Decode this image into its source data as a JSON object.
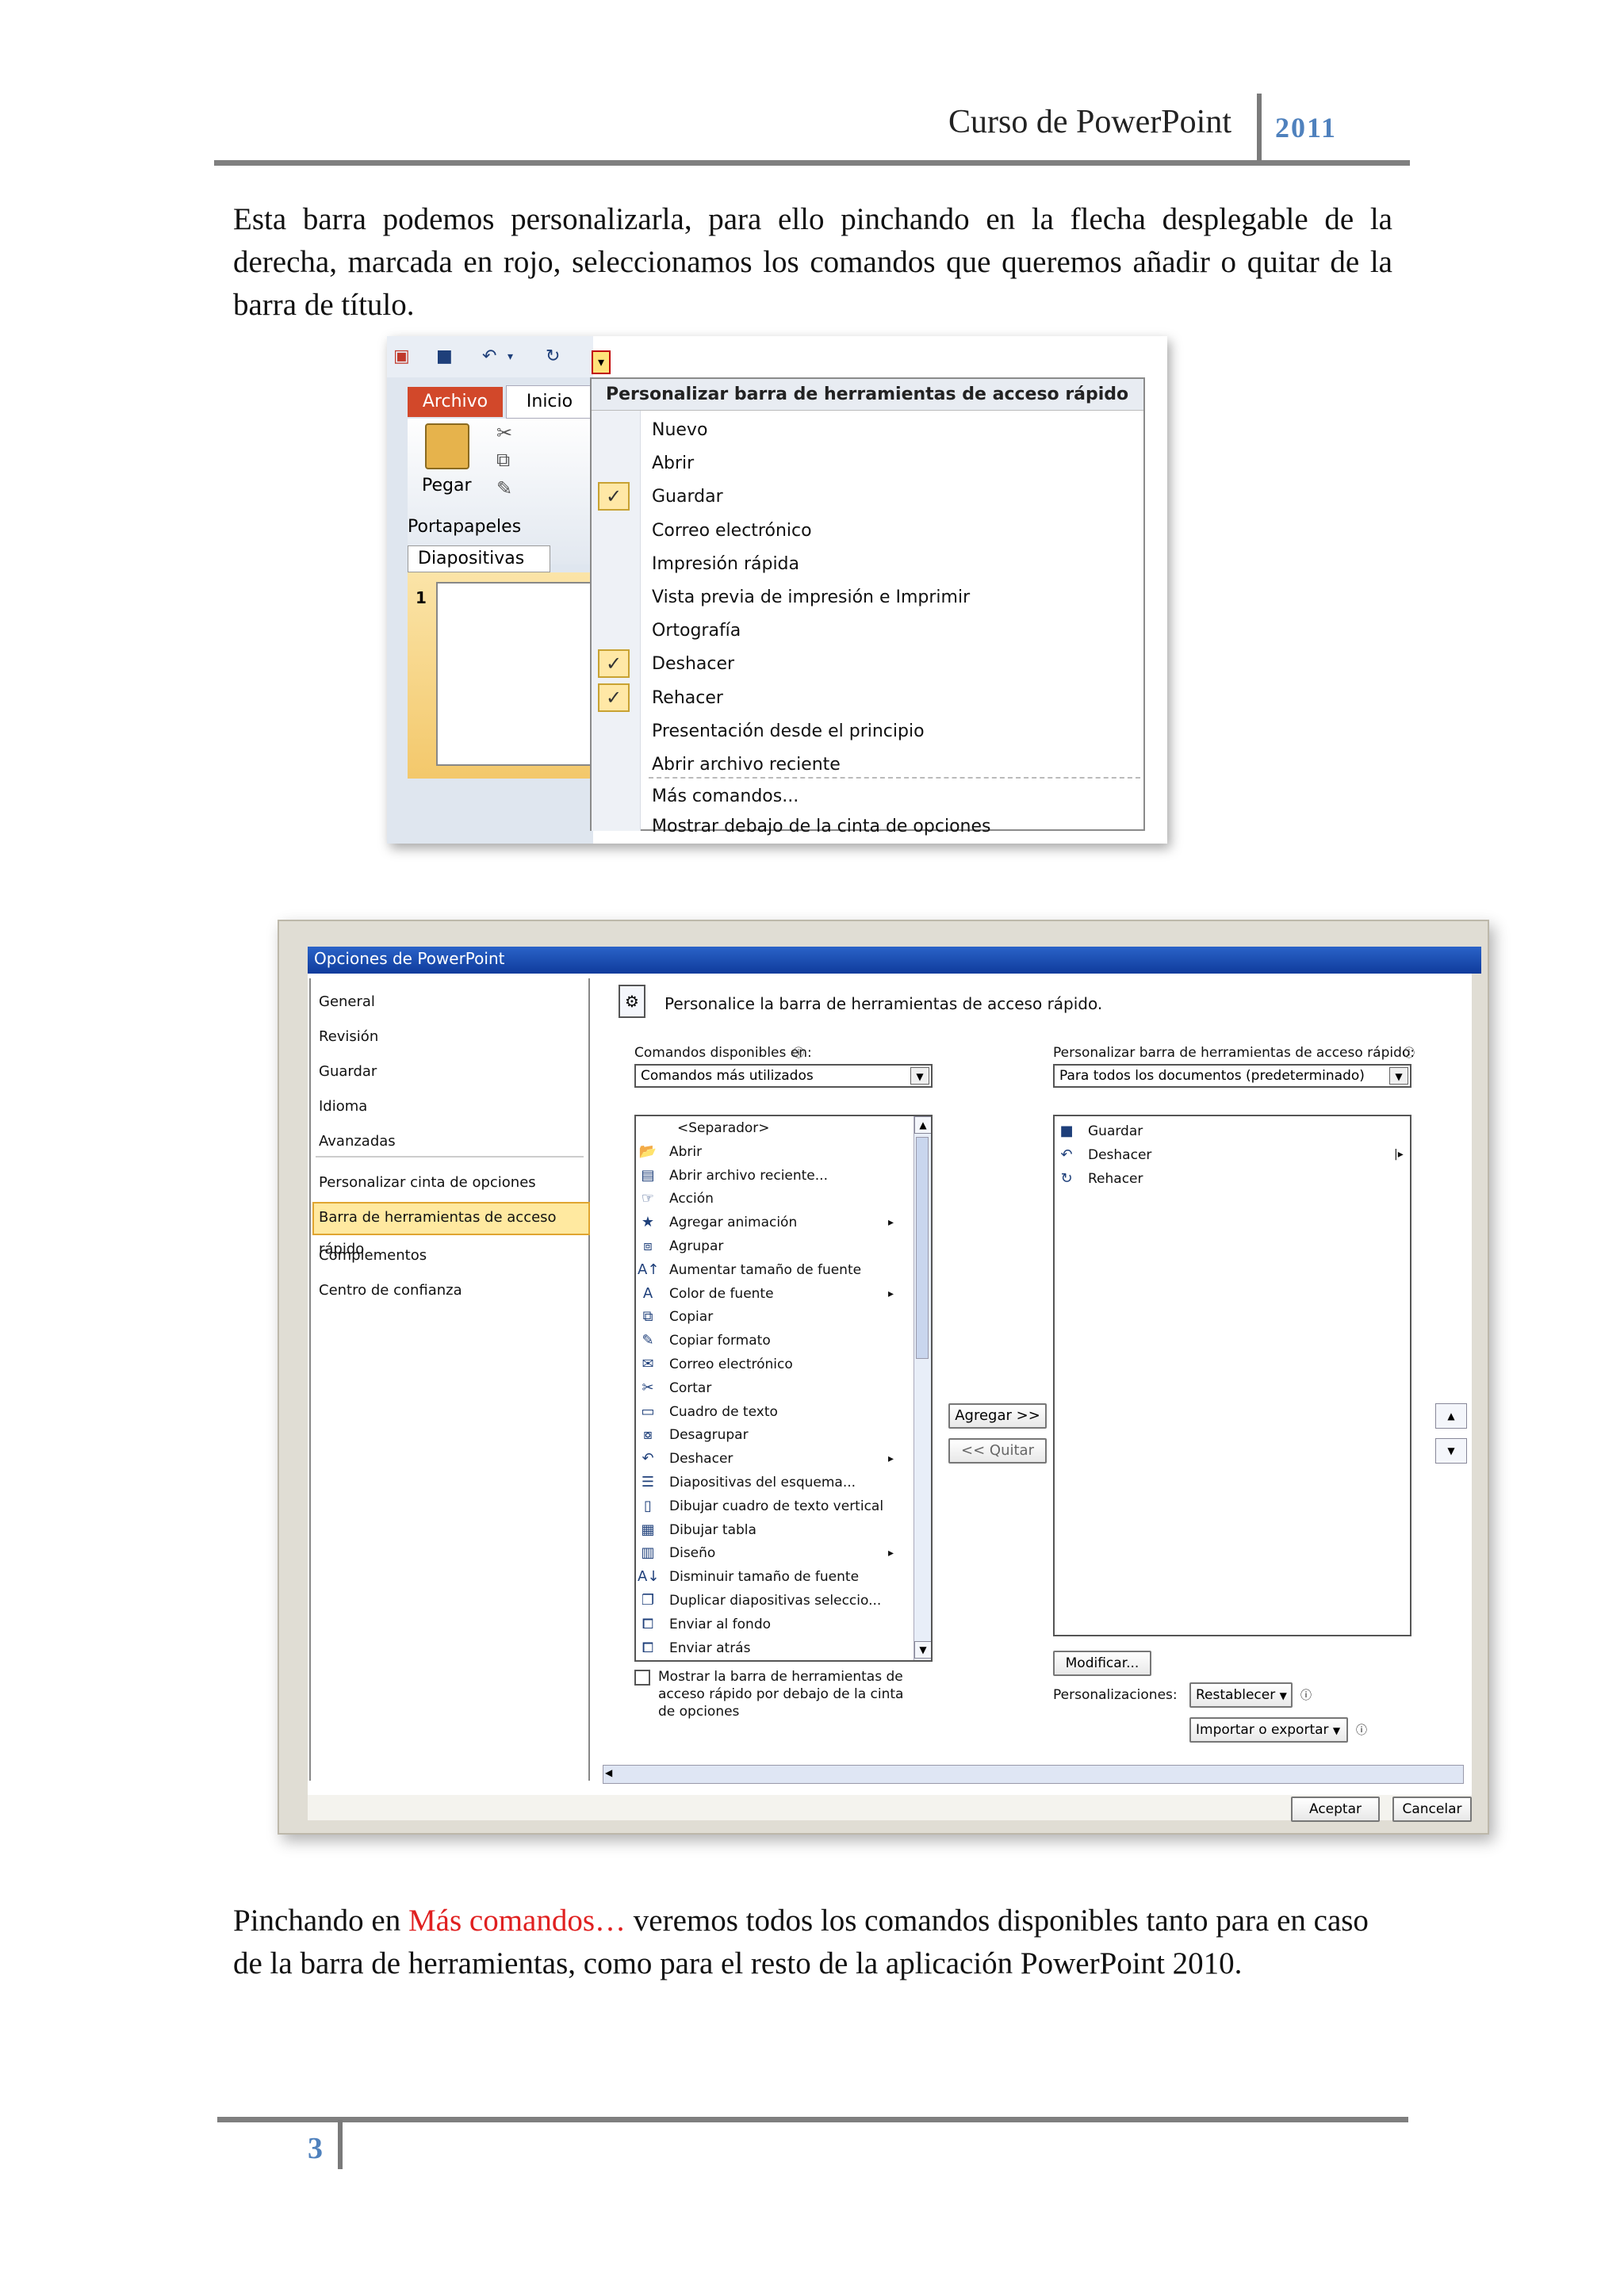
{
  "header": {
    "title": "Curso de PowerPoint",
    "year": "2011"
  },
  "paragraph1": "Esta barra podemos personalizarla, para ello pinchando en la flecha desplegable de la derecha, marcada en rojo, seleccionamos los comandos que queremos añadir o quitar de la barra de título.",
  "shot1": {
    "tab_archivo": "Archivo",
    "tab_inicio": "Inicio",
    "pegar_label": "Pegar",
    "portapapeles_label": "Portapapeles",
    "diapositivas_tab": "Diapositivas",
    "slide_number": "1",
    "menu_title": "Personalizar barra de herramientas de acceso rápido",
    "menu_items": [
      {
        "label": "Nuevo",
        "checked": false
      },
      {
        "label": "Abrir",
        "checked": false
      },
      {
        "label": "Guardar",
        "checked": true
      },
      {
        "label": "Correo electrónico",
        "checked": false
      },
      {
        "label": "Impresión rápida",
        "checked": false
      },
      {
        "label": "Vista previa de impresión e Imprimir",
        "checked": false
      },
      {
        "label": "Ortografía",
        "checked": false
      },
      {
        "label": "Deshacer",
        "checked": true
      },
      {
        "label": "Rehacer",
        "checked": true
      },
      {
        "label": "Presentación desde el principio",
        "checked": false
      },
      {
        "label": "Abrir archivo reciente",
        "checked": false
      }
    ],
    "menu_more": "Más comandos...",
    "menu_show_below": "Mostrar debajo de la cinta de opciones",
    "highlight_color": "#c00000"
  },
  "shot2": {
    "window_title": "Opciones de PowerPoint",
    "nav_items": [
      "General",
      "Revisión",
      "Guardar",
      "Idioma",
      "Avanzadas",
      "Personalizar cinta de opciones",
      "Barra de herramientas de acceso rápido",
      "Complementos",
      "Centro de confianza"
    ],
    "nav_selected": "Barra de herramientas de acceso rápido",
    "heading": "Personalice la barra de herramientas de acceso rápido.",
    "commands_label": "Comandos disponibles en:",
    "commands_value": "Comandos más utilizados",
    "customize_label": "Personalizar barra de herramientas de acceso rápido:",
    "customize_value": "Para todos los documentos (predeterminado)",
    "commands": [
      {
        "label": "<Separador>",
        "icon": "none",
        "sub": false
      },
      {
        "label": "Abrir",
        "icon": "folder-icon",
        "sub": false
      },
      {
        "label": "Abrir archivo reciente...",
        "icon": "recent-file-icon",
        "sub": false
      },
      {
        "label": "Acción",
        "icon": "action-icon",
        "sub": false
      },
      {
        "label": "Agregar animación",
        "icon": "star-icon",
        "sub": true
      },
      {
        "label": "Agrupar",
        "icon": "group-icon",
        "sub": false
      },
      {
        "label": "Aumentar tamaño de fuente",
        "icon": "font-grow-icon",
        "sub": false
      },
      {
        "label": "Color de fuente",
        "icon": "font-color-icon",
        "sub": true
      },
      {
        "label": "Copiar",
        "icon": "copy-icon",
        "sub": false
      },
      {
        "label": "Copiar formato",
        "icon": "format-painter-icon",
        "sub": false
      },
      {
        "label": "Correo electrónico",
        "icon": "email-icon",
        "sub": false
      },
      {
        "label": "Cortar",
        "icon": "scissors-icon",
        "sub": false
      },
      {
        "label": "Cuadro de texto",
        "icon": "textbox-icon",
        "sub": false
      },
      {
        "label": "Desagrupar",
        "icon": "ungroup-icon",
        "sub": false
      },
      {
        "label": "Deshacer",
        "icon": "undo-icon",
        "sub": true
      },
      {
        "label": "Diapositivas del esquema...",
        "icon": "outline-icon",
        "sub": false
      },
      {
        "label": "Dibujar cuadro de texto vertical",
        "icon": "vertical-textbox-icon",
        "sub": false
      },
      {
        "label": "Dibujar tabla",
        "icon": "table-icon",
        "sub": false
      },
      {
        "label": "Diseño",
        "icon": "layout-icon",
        "sub": true
      },
      {
        "label": "Disminuir tamaño de fuente",
        "icon": "font-shrink-icon",
        "sub": false
      },
      {
        "label": "Duplicar diapositivas seleccio...",
        "icon": "duplicate-icon",
        "sub": false
      },
      {
        "label": "Enviar al fondo",
        "icon": "send-back-icon",
        "sub": false
      },
      {
        "label": "Enviar atrás",
        "icon": "send-backward-icon",
        "sub": false
      }
    ],
    "qat_items": [
      {
        "label": "Guardar",
        "icon": "save-icon"
      },
      {
        "label": "Deshacer",
        "icon": "undo-icon"
      },
      {
        "label": "Rehacer",
        "icon": "redo-icon"
      }
    ],
    "add_button": "Agregar >>",
    "remove_button": "<< Quitar",
    "modify_button": "Modificar...",
    "show_below_label": "Mostrar la barra de herramientas de acceso rápido por debajo de la cinta de opciones",
    "customizations_label": "Personalizaciones:",
    "reset_button": "Restablecer",
    "import_export_button": "Importar o exportar",
    "ok_button": "Aceptar",
    "cancel_button": "Cancelar"
  },
  "paragraph2": {
    "before": "Pinchando en ",
    "highlight": "Más comandos…",
    "after": " veremos todos los comandos disponibles tanto para en caso de la barra de herramientas, como para el resto de la aplicación PowerPoint 2010.",
    "highlight_color": "#e02020"
  },
  "footer": {
    "page": "3"
  }
}
